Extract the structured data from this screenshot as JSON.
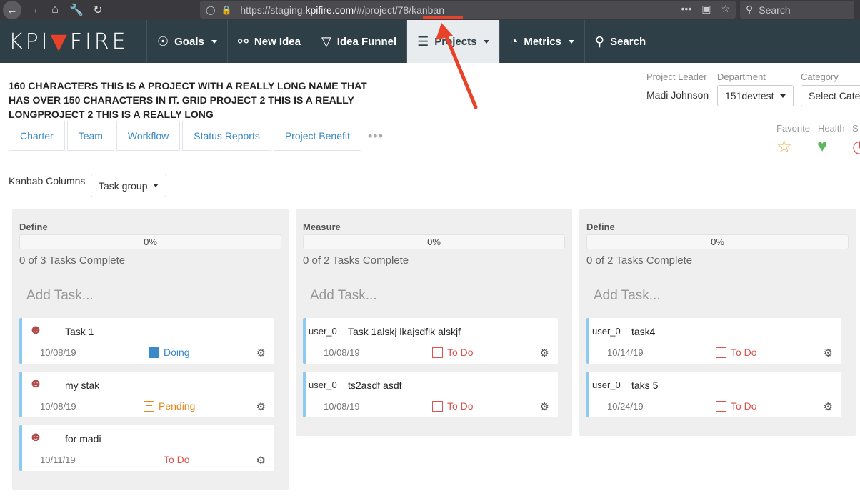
{
  "browser": {
    "url_prefix": "https://staging.",
    "url_domain": "kpifire.com",
    "url_path": "/#/project/78/kanban",
    "search_placeholder": "Search"
  },
  "nav": {
    "logo_left": "KPI",
    "logo_right": "FIRE",
    "items": [
      {
        "label": "Goals",
        "icon": "compass-icon"
      },
      {
        "label": "New Idea",
        "icon": "lightbulb-icon"
      },
      {
        "label": "Idea Funnel",
        "icon": "funnel-icon"
      },
      {
        "label": "Projects",
        "icon": "layers-icon"
      },
      {
        "label": "Metrics",
        "icon": "gauge-icon"
      },
      {
        "label": "Search",
        "icon": "search-icon"
      }
    ]
  },
  "project": {
    "title": "160 CHARACTERS THIS IS A PROJECT WITH A REALLY LONG NAME THAT HAS OVER 150 CHARACTERS IN IT. GRID PROJECT 2 THIS IS A REALLY LONGPROJECT 2 THIS IS A REALLY LONG",
    "leader_label": "Project Leader",
    "leader": "Madi Johnson",
    "department_label": "Department",
    "department": "151devtest",
    "category_label": "Category",
    "category": "Select Cate",
    "favorite_label": "Favorite",
    "health_label": "Health",
    "status_label_partial": "S"
  },
  "tabs": [
    "Charter",
    "Team",
    "Workflow",
    "Status Reports",
    "Project Benefit"
  ],
  "more": "•••",
  "kanban": {
    "columns_label": "Kanbab Columns",
    "group_by": "Task group",
    "add_placeholder": "Add Task...",
    "columns": [
      {
        "title": "Define",
        "progress": "0%",
        "complete": "0 of 3 Tasks Complete",
        "cards": [
          {
            "owner": "",
            "name": "Task 1",
            "date": "10/08/19",
            "status": "Doing"
          },
          {
            "owner": "",
            "name": "my stak",
            "date": "10/08/19",
            "status": "Pending"
          },
          {
            "owner": "",
            "name": "for madi",
            "date": "10/11/19",
            "status": "To Do"
          }
        ]
      },
      {
        "title": "Measure",
        "progress": "0%",
        "complete": "0 of 2 Tasks Complete",
        "cards": [
          {
            "owner": "user_0",
            "name": "Task 1alskj lkajsdflk alskjf",
            "date": "10/08/19",
            "status": "To Do"
          },
          {
            "owner": "user_0",
            "name": "ts2asdf asdf",
            "date": "10/08/19",
            "status": "To Do"
          }
        ]
      },
      {
        "title": "Define",
        "progress": "0%",
        "complete": "0 of 2 Tasks Complete",
        "cards": [
          {
            "owner": "user_0",
            "name": "task4",
            "date": "10/14/19",
            "status": "To Do"
          },
          {
            "owner": "user_0",
            "name": "taks 5",
            "date": "10/24/19",
            "status": "To Do"
          }
        ]
      }
    ]
  },
  "colors": {
    "navbar": "#2f3f47",
    "accent_red": "#e8432a",
    "link_blue": "#3a89c9",
    "card_border": "#8ccaf0",
    "todo_red": "#d9534f",
    "pending_orange": "#e08a1e",
    "health_green": "#5cb85c",
    "favorite_orange": "#f0ad4e"
  }
}
